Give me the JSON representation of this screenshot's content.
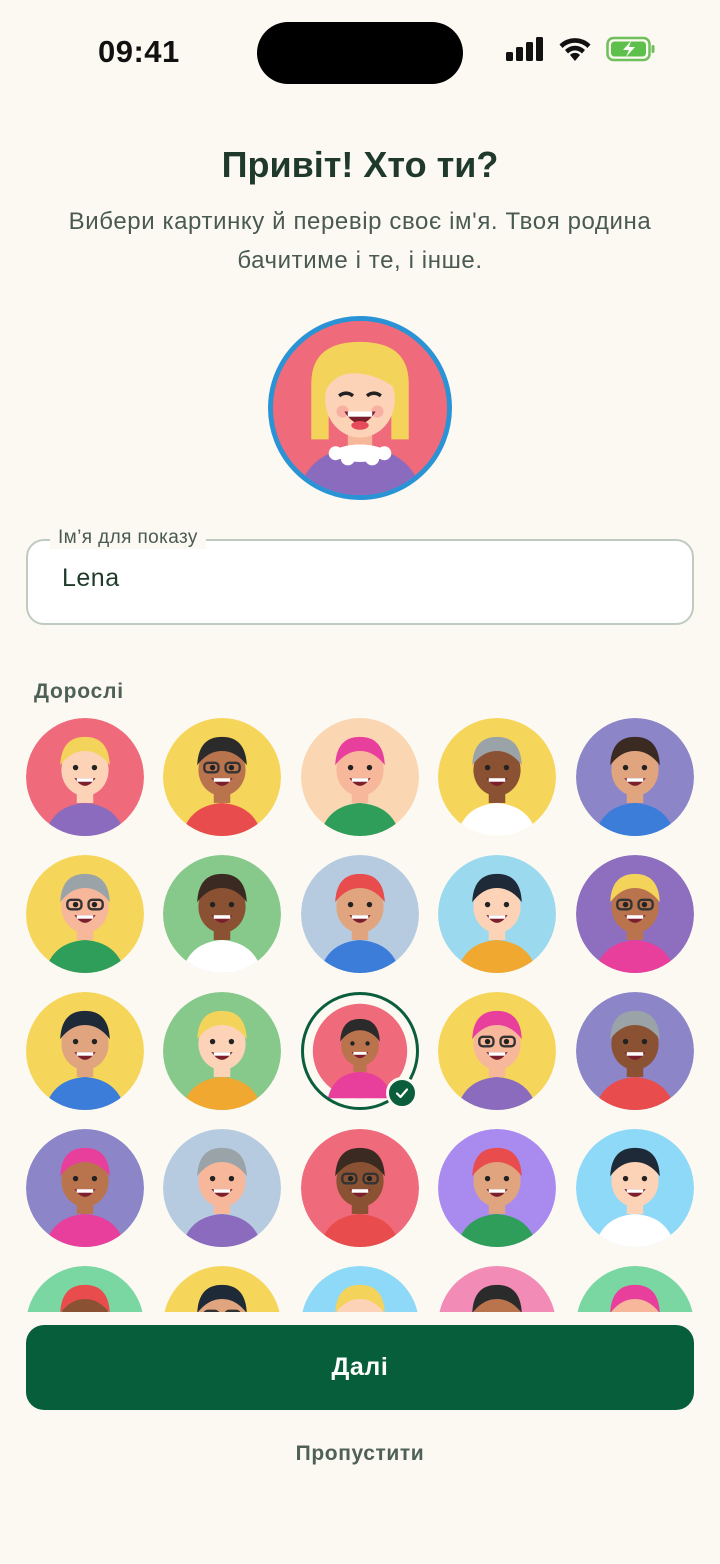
{
  "status": {
    "time": "09:41"
  },
  "header": {
    "title": "Привіт! Хто ти?",
    "subtitle": "Вибери картинку й перевір своє ім'я. Твоя родина бачитиме і те, і інше."
  },
  "name_field": {
    "label": "Ім’я для показу",
    "value": "Lena"
  },
  "avatars": {
    "section_label": "Дорослі",
    "selected_index": 12,
    "bg_colors": [
      "#EF6A7A",
      "#F6D65A",
      "#FBD6B2",
      "#F6D65A",
      "#8C86C9",
      "#F6D65A",
      "#86C98B",
      "#B7CBE0",
      "#9BD9EE",
      "#8E6FBF",
      "#F6D65A",
      "#86C98B",
      "#EF6A7A",
      "#F6D65A",
      "#8C86C9",
      "#8C86C9",
      "#B7CBE0",
      "#EF6A7A",
      "#A98BF0",
      "#8ED8F8",
      "#7AD7A1",
      "#F6D65A",
      "#8ED8F8",
      "#F28BB5",
      "#7AD7A1"
    ]
  },
  "actions": {
    "next_label": "Далі",
    "skip_label": "Пропустити"
  }
}
